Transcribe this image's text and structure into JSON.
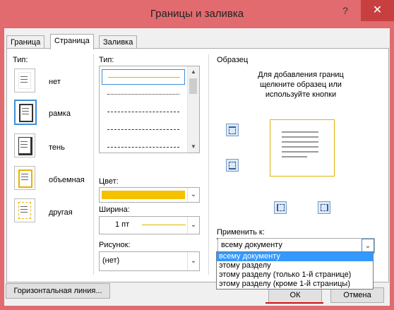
{
  "window": {
    "title": "Границы и заливка",
    "help_icon": "?",
    "close_icon": "✕"
  },
  "tabs": [
    {
      "label": "Граница",
      "active": false
    },
    {
      "label": "Страница",
      "active": true
    },
    {
      "label": "Заливка",
      "active": false
    }
  ],
  "settings": {
    "label": "Тип:",
    "items": [
      {
        "label": "нет",
        "selected": false
      },
      {
        "label": "рамка",
        "selected": true
      },
      {
        "label": "тень",
        "selected": false
      },
      {
        "label": "объемная",
        "selected": false
      },
      {
        "label": "другая",
        "selected": false
      }
    ]
  },
  "style": {
    "label": "Тип:",
    "lines": [
      "solid",
      "dotted",
      "dashed-small",
      "dashed",
      "dash-dot"
    ],
    "selected_index": 0,
    "scroll_up": "▲",
    "scroll_down": "▼"
  },
  "color": {
    "label": "Цвет:",
    "value_color": "#f5c000",
    "arrow": "⌄"
  },
  "width": {
    "label": "Ширина:",
    "value": "1 пт",
    "arrow": "⌄"
  },
  "art": {
    "label": "Рисунок:",
    "value": "(нет)",
    "arrow": "⌄"
  },
  "preview": {
    "label": "Образец",
    "instruction": "Для добавления границ щелкните образец или используйте кнопки"
  },
  "apply_to": {
    "label": "Применить к:",
    "value": "всему документу",
    "arrow": "⌄",
    "options": [
      "всему документу",
      "этому разделу",
      "этому разделу (только 1-й странице)",
      "этому разделу (кроме 1-й страницы)"
    ],
    "selected_index": 0
  },
  "buttons": {
    "horizontal_line": "Горизонтальная линия...",
    "ok": "ОК",
    "cancel": "Отмена"
  },
  "colors": {
    "accent": "#3399ff",
    "title_bar": "#e26b6f",
    "close": "#c7403f",
    "border_yellow": "#e4b400"
  }
}
